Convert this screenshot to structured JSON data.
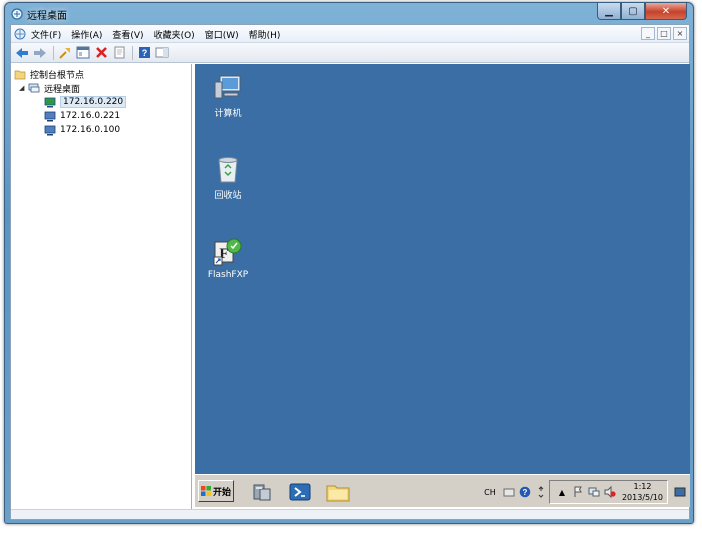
{
  "window": {
    "title": "远程桌面"
  },
  "menu": {
    "items": [
      "文件(F)",
      "操作(A)",
      "查看(V)",
      "收藏夹(O)",
      "窗口(W)",
      "帮助(H)"
    ]
  },
  "mdi_controls": [
    "_",
    "□",
    "×"
  ],
  "toolbar": {
    "buttons": [
      "back-icon",
      "forward-icon",
      "up-icon",
      "console-tree-icon",
      "delete-icon",
      "properties-icon",
      "help-icon",
      "panel-icon"
    ]
  },
  "tree": {
    "root": "控制台根节点",
    "group": "远程桌面",
    "hosts": [
      "172.16.0.220",
      "172.16.0.221",
      "172.16.0.100"
    ]
  },
  "desktop": {
    "icons": [
      "计算机",
      "回收站",
      "FlashFXP"
    ]
  },
  "taskbar": {
    "start_label": "开始",
    "tray_text": "CH",
    "clock_time": "1:12",
    "clock_date": "2013/5/10"
  },
  "colors": {
    "desktop": "#3a6ea5",
    "taskbar": "#d4d0c8",
    "window_frame": "#6aa0c8"
  }
}
